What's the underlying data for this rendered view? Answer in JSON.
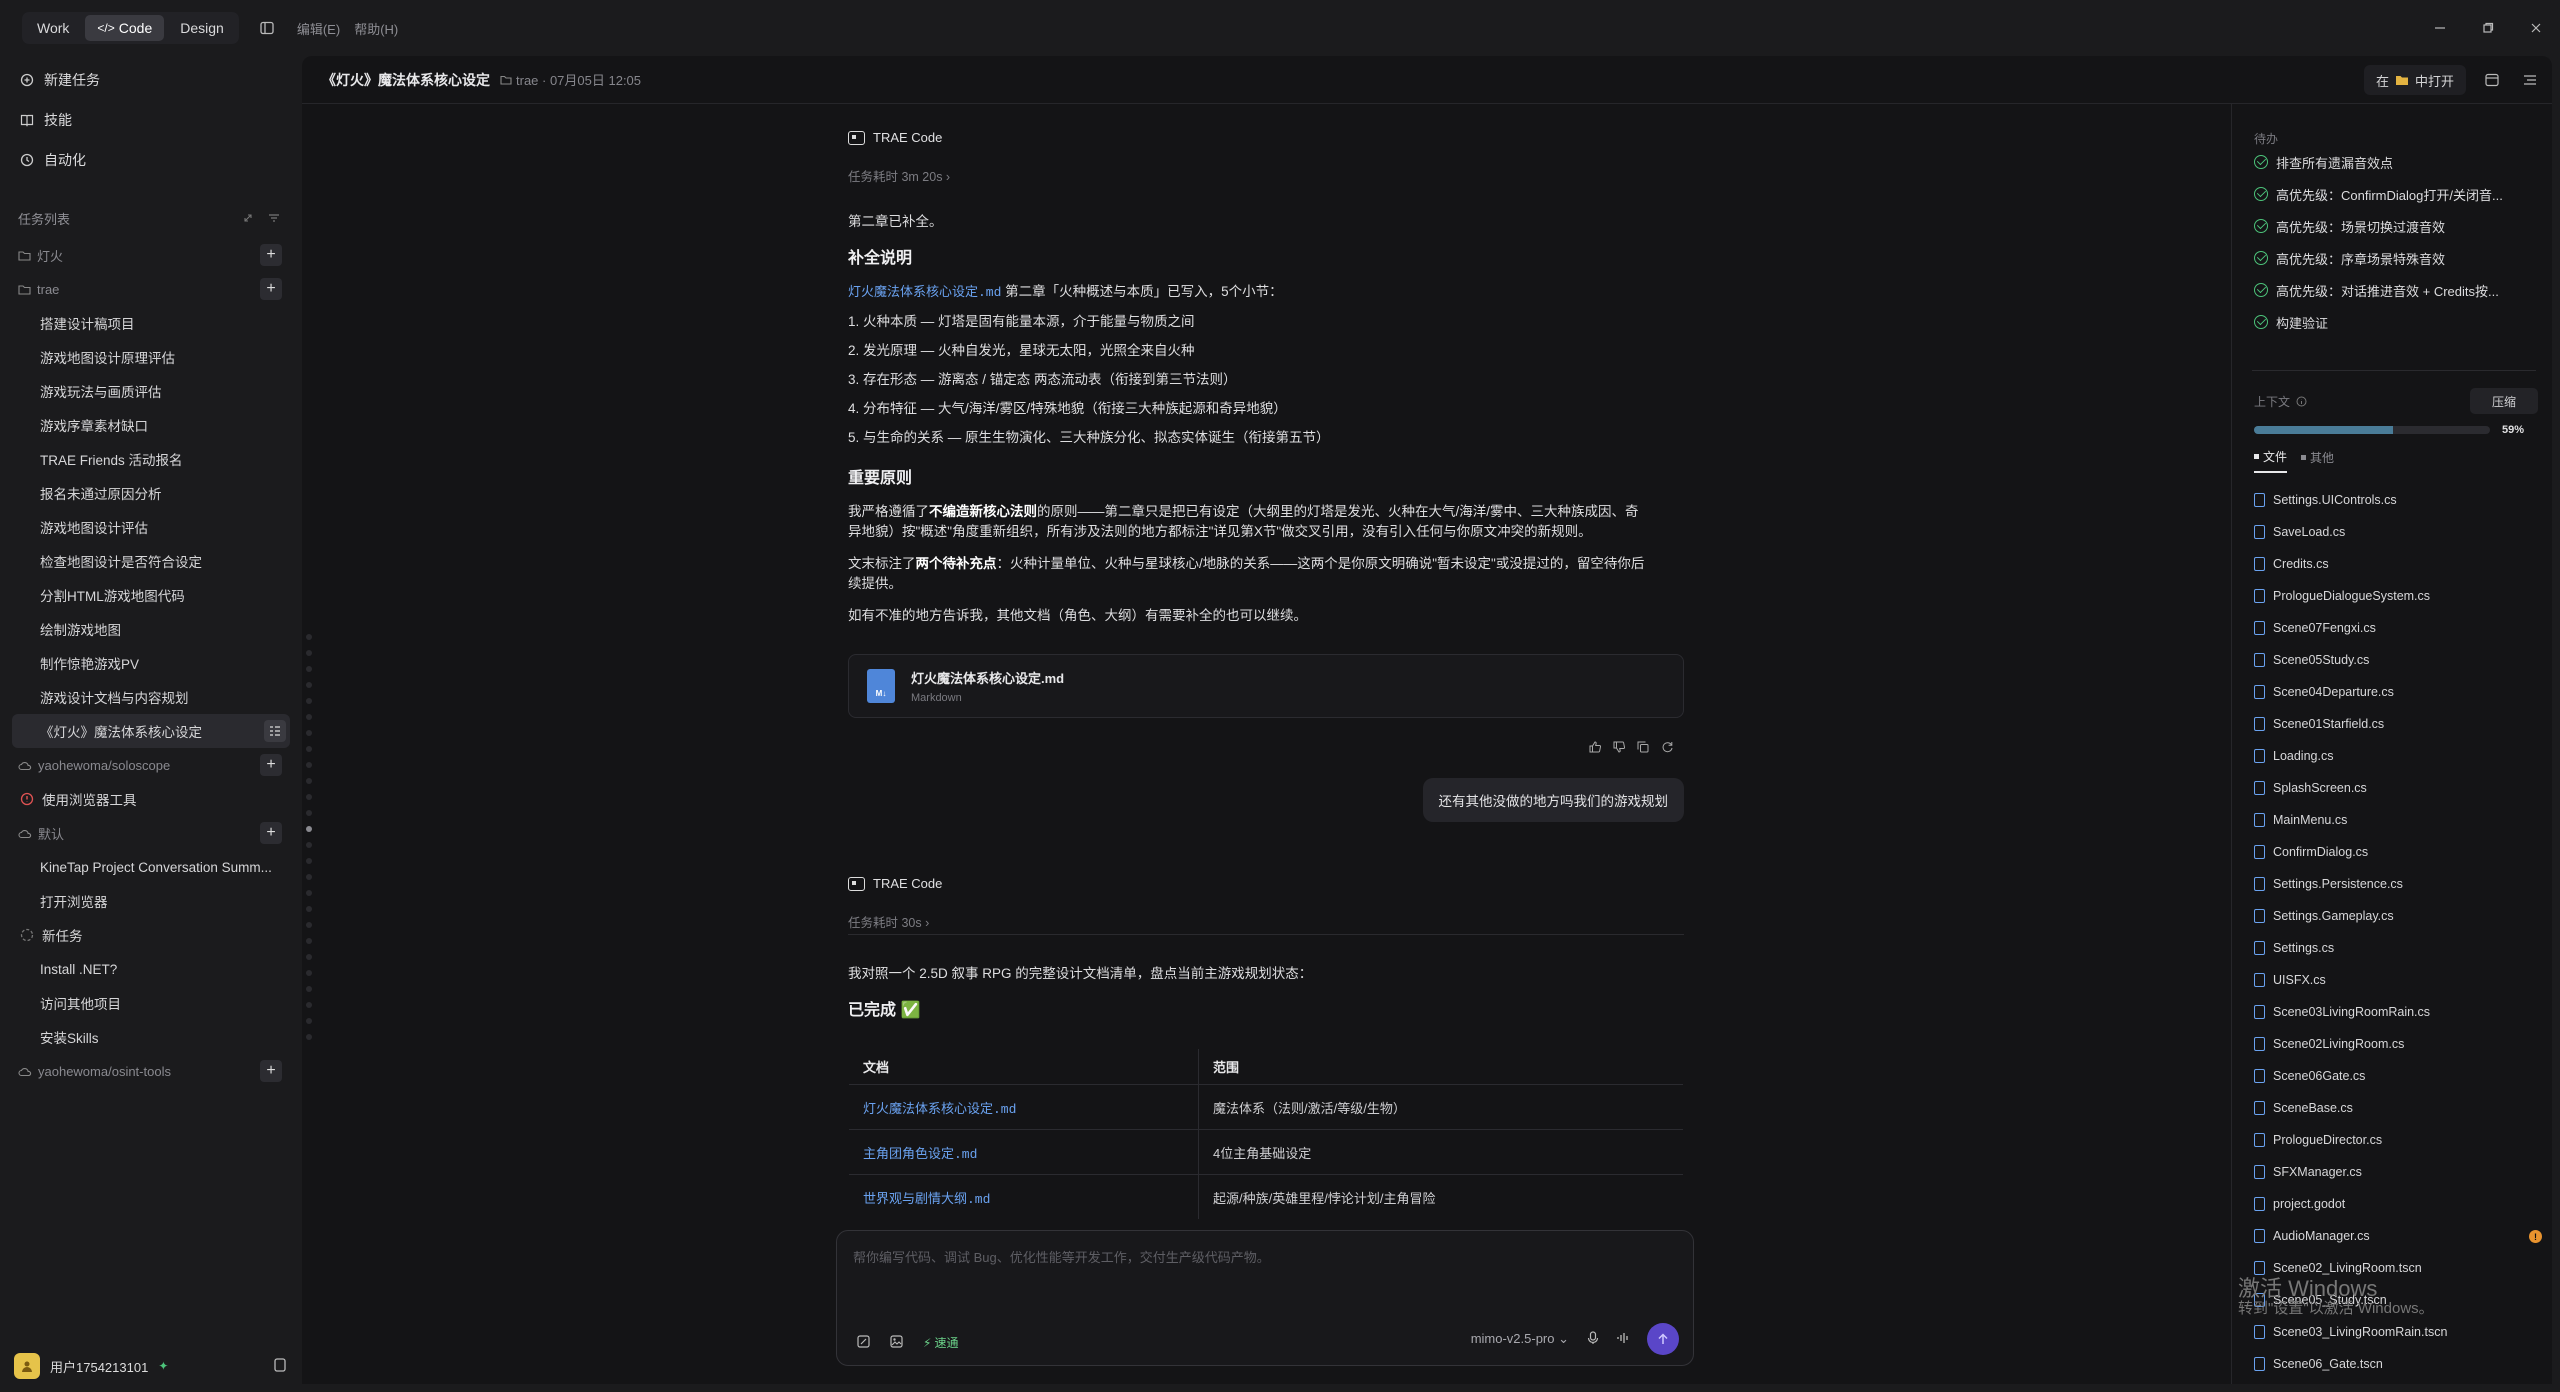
{
  "topbar": {
    "modes": [
      "Work",
      "Code",
      "Design"
    ],
    "menu": [
      "编辑(E)",
      "帮助(H)"
    ]
  },
  "sidebar": {
    "top": [
      "新建任务",
      "技能",
      "自动化"
    ],
    "tasklist_label": "任务列表",
    "groups": [
      {
        "name": "灯火",
        "tasks": []
      },
      {
        "name": "trae",
        "tasks": [
          "搭建设计稿项目",
          "游戏地图设计原理评估",
          "游戏玩法与画质评估",
          "游戏序章素材缺口",
          "TRAE Friends 活动报名",
          "报名未通过原因分析",
          "游戏地图设计评估",
          "检查地图设计是否符合设定",
          "分割HTML游戏地图代码",
          "绘制游戏地图",
          "制作惊艳游戏PV",
          "游戏设计文档与内容规划",
          "《灯火》魔法体系核心设定"
        ]
      },
      {
        "name": "yaohewoma/soloscope",
        "tasks": []
      },
      {
        "name": "默认",
        "tasks": [
          "KineTap Project Conversation Summ...",
          "打开浏览器"
        ]
      },
      {
        "name": "yaohewoma/osint-tools",
        "tasks": []
      }
    ],
    "browser_tool": "使用浏览器工具",
    "new_task": "新任务",
    "extra_tasks": [
      "Install .NET?",
      "访问其他项目",
      "安装Skills"
    ],
    "user": "用户1754213101"
  },
  "header": {
    "title": "《灯火》魔法体系核心设定",
    "meta": "trae · 07月05日 12:05",
    "open_in": "在",
    "open_in2": "中打开"
  },
  "chat": {
    "bot_name": "TRAE Code",
    "msg1": {
      "elapsed": "任务耗时 3m 20s ›",
      "intro": "第二章已补全。",
      "h1": "补全说明",
      "link": "灯火魔法体系核心设定.md",
      "line1_rest": " 第二章「火种概述与本质」已写入，5个小节：",
      "items": [
        "1. 火种本质 — 灯塔是固有能量本源，介于能量与物质之间",
        "2. 发光原理 — 火种自发光，星球无太阳，光照全来自火种",
        "3. 存在形态 — 游离态 / 锚定态 两态流动表（衔接到第三节法则）",
        "4. 分布特征 — 大气/海洋/雾区/特殊地貌（衔接三大种族起源和奇异地貌）",
        "5. 与生命的关系 — 原生生物演化、三大种族分化、拟态实体诞生（衔接第五节）"
      ],
      "h2": "重要原则",
      "para1a": "我严格遵循了",
      "para1b": "不编造新核心法则",
      "para1c": "的原则——第二章只是把已有设定（大纲里的灯塔是发光、火种在大气/海洋/雾中、三大种族成因、奇",
      "para1d": "异地貌）按\"概述\"角度重新组织，所有涉及法则的地方都标注\"详见第X节\"做交叉引用，没有引入任何与你原文冲突的新规则。",
      "para2a": "文末标注了",
      "para2b": "两个待补充点",
      "para2c": "：火种计量单位、火种与星球核心/地脉的关系——这两个是你原文明确说\"暂未设定\"或没提过的，留空待你后",
      "para2d": "续提供。",
      "para3": "如有不准的地方告诉我，其他文档（角色、大纲）有需要补全的也可以继续。",
      "file_name": "灯火魔法体系核心设定.md",
      "file_type": "Markdown"
    },
    "user_msg": "还有其他没做的地方吗我们的游戏规划",
    "msg2": {
      "elapsed": "任务耗时 30s ›",
      "intro": "我对照一个 2.5D 叙事 RPG 的完整设计文档清单，盘点当前主游戏规划状态：",
      "h1": "已完成 ✅",
      "table_head": [
        "文档",
        "范围"
      ],
      "rows": [
        [
          "灯火魔法体系核心设定.md",
          "魔法体系（法则/激活/等级/生物）"
        ],
        [
          "主角团角色设定.md",
          "4位主角基础设定"
        ],
        [
          "世界观与剧情大纲.md",
          "起源/种族/英雄里程/悖论计划/主角冒险"
        ]
      ]
    }
  },
  "input": {
    "placeholder": "帮你编写代码、调试 Bug、优化性能等开发工作，交付生产级代码产物。",
    "fast": "速通",
    "model": "mimo-v2.5-pro ⌄"
  },
  "todos": {
    "label": "待办",
    "items": [
      "排查所有遗漏音效点",
      "高优先级：ConfirmDialog打开/关闭音...",
      "高优先级：场景切换过渡音效",
      "高优先级：序章场景特殊音效",
      "高优先级：对话推进音效 + Credits按...",
      "构建验证"
    ]
  },
  "context": {
    "label": "上下文",
    "compress": "压缩",
    "percent": "59%",
    "fill": 0.59,
    "tabs": [
      "文件",
      "其他"
    ]
  },
  "files": [
    "Settings.UIControls.cs",
    "SaveLoad.cs",
    "Credits.cs",
    "PrologueDialogueSystem.cs",
    "Scene07Fengxi.cs",
    "Scene05Study.cs",
    "Scene04Departure.cs",
    "Scene01Starfield.cs",
    "Loading.cs",
    "SplashScreen.cs",
    "MainMenu.cs",
    "ConfirmDialog.cs",
    "Settings.Persistence.cs",
    "Settings.Gameplay.cs",
    "Settings.cs",
    "UISFX.cs",
    "Scene03LivingRoomRain.cs",
    "Scene02LivingRoom.cs",
    "Scene06Gate.cs",
    "SceneBase.cs",
    "PrologueDirector.cs",
    "SFXManager.cs",
    "project.godot",
    "AudioManager.cs",
    "Scene02_LivingRoom.tscn",
    "Scene05_Study.tscn",
    "Scene03_LivingRoomRain.tscn",
    "Scene06_Gate.tscn"
  ],
  "watermark": {
    "line1": "激活 Windows",
    "line2": "转到\"设置\"以激活 Windows。"
  }
}
